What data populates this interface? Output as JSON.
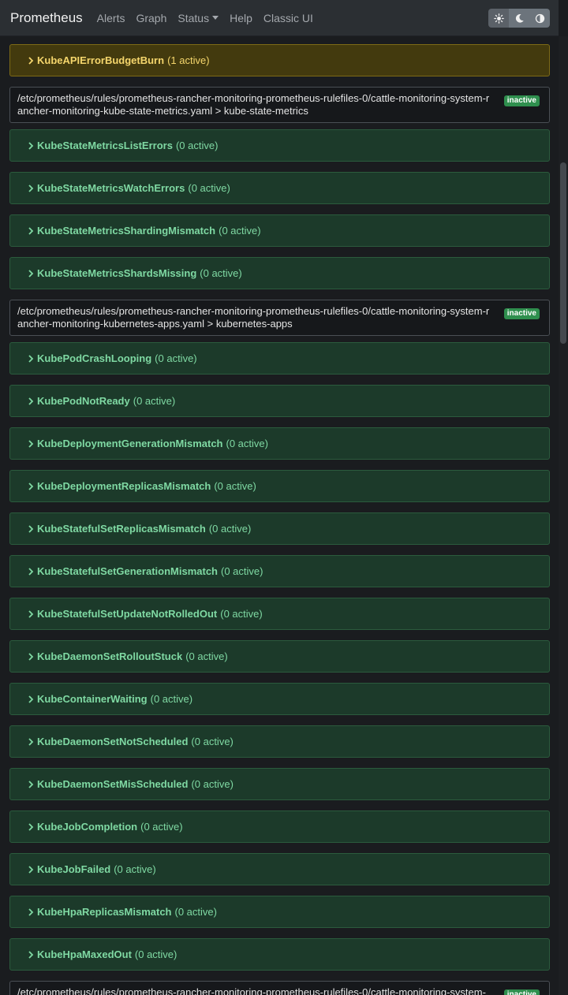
{
  "navbar": {
    "brand": "Prometheus",
    "links": [
      "Alerts",
      "Graph",
      "Status",
      "Help",
      "Classic UI"
    ],
    "theme_buttons": [
      "sun-icon",
      "moon-icon",
      "contrast-icon"
    ]
  },
  "top_alert": {
    "name": "KubeAPIErrorBudgetBurn",
    "count": "(1 active)"
  },
  "groups": [
    {
      "path": "/etc/prometheus/rules/prometheus-rancher-monitoring-prometheus-rulefiles-0/cattle-monitoring-system-rancher-monitoring-kube-state-metrics.yaml > kube-state-metrics",
      "state": "inactive",
      "alerts": [
        {
          "name": "KubeStateMetricsListErrors",
          "count": "(0 active)"
        },
        {
          "name": "KubeStateMetricsWatchErrors",
          "count": "(0 active)"
        },
        {
          "name": "KubeStateMetricsShardingMismatch",
          "count": "(0 active)"
        },
        {
          "name": "KubeStateMetricsShardsMissing",
          "count": "(0 active)"
        }
      ]
    },
    {
      "path": "/etc/prometheus/rules/prometheus-rancher-monitoring-prometheus-rulefiles-0/cattle-monitoring-system-rancher-monitoring-kubernetes-apps.yaml > kubernetes-apps",
      "state": "inactive",
      "alerts": [
        {
          "name": "KubePodCrashLooping",
          "count": "(0 active)"
        },
        {
          "name": "KubePodNotReady",
          "count": "(0 active)"
        },
        {
          "name": "KubeDeploymentGenerationMismatch",
          "count": "(0 active)"
        },
        {
          "name": "KubeDeploymentReplicasMismatch",
          "count": "(0 active)"
        },
        {
          "name": "KubeStatefulSetReplicasMismatch",
          "count": "(0 active)"
        },
        {
          "name": "KubeStatefulSetGenerationMismatch",
          "count": "(0 active)"
        },
        {
          "name": "KubeStatefulSetUpdateNotRolledOut",
          "count": "(0 active)"
        },
        {
          "name": "KubeDaemonSetRolloutStuck",
          "count": "(0 active)"
        },
        {
          "name": "KubeContainerWaiting",
          "count": "(0 active)"
        },
        {
          "name": "KubeDaemonSetNotScheduled",
          "count": "(0 active)"
        },
        {
          "name": "KubeDaemonSetMisScheduled",
          "count": "(0 active)"
        },
        {
          "name": "KubeJobCompletion",
          "count": "(0 active)"
        },
        {
          "name": "KubeJobFailed",
          "count": "(0 active)"
        },
        {
          "name": "KubeHpaReplicasMismatch",
          "count": "(0 active)"
        },
        {
          "name": "KubeHpaMaxedOut",
          "count": "(0 active)"
        }
      ]
    },
    {
      "path": "/etc/prometheus/rules/prometheus-rancher-monitoring-prometheus-rulefiles-0/cattle-monitoring-system-",
      "state": "inactive",
      "alerts": []
    }
  ],
  "colors": {
    "firing_bg": "#433a0e",
    "firing_text": "#f5d66c",
    "inactive_bg": "#1c3a2a",
    "inactive_text": "#7fd9a3",
    "badge_bg": "#2f8f4e"
  }
}
